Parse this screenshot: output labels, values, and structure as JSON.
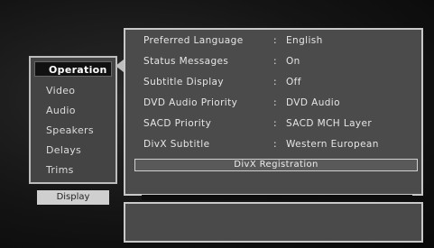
{
  "sidebar": {
    "items": [
      {
        "label": "Operation",
        "selected": true
      },
      {
        "label": "Video",
        "selected": false
      },
      {
        "label": "Audio",
        "selected": false
      },
      {
        "label": "Speakers",
        "selected": false
      },
      {
        "label": "Delays",
        "selected": false
      },
      {
        "label": "Trims",
        "selected": false
      }
    ],
    "tab_label": "Display"
  },
  "settings": [
    {
      "label": "Preferred Language",
      "value": "English"
    },
    {
      "label": "Status Messages",
      "value": "On"
    },
    {
      "label": "Subtitle Display",
      "value": "Off"
    },
    {
      "label": "DVD Audio Priority",
      "value": "DVD Audio"
    },
    {
      "label": "SACD Priority",
      "value": "SACD MCH Layer"
    },
    {
      "label": "DivX Subtitle",
      "value": "Western European"
    }
  ],
  "separator": ":",
  "divx_registration_label": "DivX Registration",
  "info_text": ""
}
